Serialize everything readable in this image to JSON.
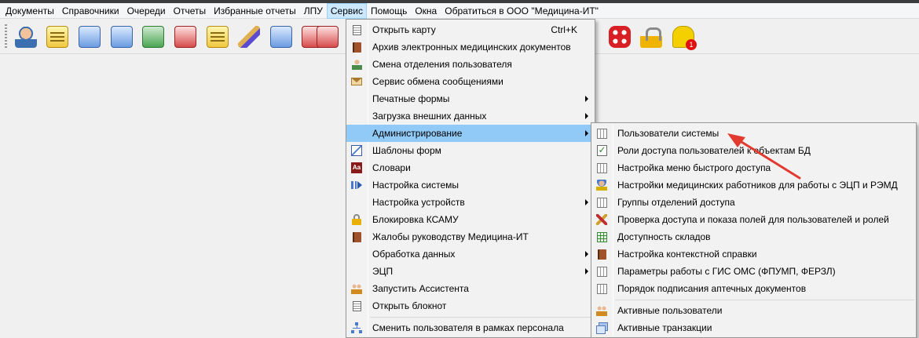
{
  "menubar": {
    "items": [
      "Документы",
      "Справочники",
      "Очереди",
      "Отчеты",
      "Избранные отчеты",
      "ЛПУ",
      "Сервис",
      "Помощь",
      "Окна",
      "Обратиться в ООО \"Медицина-ИТ\""
    ],
    "active": "Сервис"
  },
  "toolbar": {
    "icons": [
      "doctor-icon",
      "card-icon",
      "card-list-icon",
      "badge-icon",
      "card-add-icon",
      "vials-icon",
      "notepad-icon",
      "syringe-icon",
      "schedule-icon",
      "pills-icon",
      "first-aid-icon",
      "security-squares-icon",
      "lock-icon",
      "messages-icon"
    ]
  },
  "service_menu": {
    "items": [
      {
        "label": "Открыть карту",
        "shortcut": "Ctrl+K",
        "icon": "open-card-icon"
      },
      {
        "label": "Архив электронных медицинских документов",
        "icon": "archive-book-icon"
      },
      {
        "label": "Смена отделения пользователя",
        "icon": "user-icon"
      },
      {
        "label": "Сервис обмена сообщениями",
        "icon": "envelope-icon"
      },
      {
        "label": "Печатные формы",
        "submenu": true
      },
      {
        "label": "Загрузка внешних данных",
        "submenu": true
      },
      {
        "label": "Администрирование",
        "submenu": true,
        "highlighted": true
      },
      {
        "label": "Шаблоны форм",
        "icon": "form-template-icon"
      },
      {
        "label": "Словари",
        "icon": "dictionary-icon"
      },
      {
        "label": "Настройка системы",
        "icon": "system-settings-icon"
      },
      {
        "label": "Настройка устройств",
        "submenu": true
      },
      {
        "label": "Блокировка КСАМУ",
        "icon": "lock-icon"
      },
      {
        "label": "Жалобы руководству Медицина-ИТ",
        "icon": "complaint-book-icon"
      },
      {
        "label": "Обработка данных",
        "submenu": true
      },
      {
        "label": "ЭЦП",
        "submenu": true
      },
      {
        "label": "Запустить Ассистента",
        "icon": "assistant-icon"
      },
      {
        "label": "Открыть блокнот",
        "icon": "notepad-icon"
      },
      {
        "label": "Сменить пользователя в рамках персонала",
        "icon": "switch-user-icon"
      }
    ]
  },
  "admin_submenu": {
    "items": [
      {
        "label": "Пользователи системы",
        "icon": "grid-icon"
      },
      {
        "label": "Роли доступа пользователей к объектам БД",
        "icon": "certificate-icon"
      },
      {
        "label": "Настройка меню быстрого доступа",
        "icon": "grid-icon"
      },
      {
        "label": "Настройки медицинских работников для работы с ЭЦП и РЭМД",
        "icon": "medical-worker-icon"
      },
      {
        "label": "Группы отделений доступа",
        "icon": "grid-icon"
      },
      {
        "label": "Проверка доступа и показа полей для пользователей и ролей",
        "icon": "tools-icon"
      },
      {
        "label": "Доступность складов",
        "icon": "green-grid-icon"
      },
      {
        "label": "Настройка контекстной справки",
        "icon": "help-book-icon"
      },
      {
        "label": "Параметры работы с ГИС ОМС (ФПУМП, ФЕРЗЛ)",
        "icon": "grid-icon"
      },
      {
        "label": "Порядок подписания аптечных документов",
        "icon": "grid-icon"
      },
      {
        "label": "Активные пользователи",
        "icon": "users-icon"
      },
      {
        "label": "Активные транзакции",
        "icon": "transactions-icon"
      }
    ]
  },
  "colors": {
    "menubar_active": "#cce8ff",
    "menu_highlight": "#91c9f7",
    "annotation_arrow": "#e23a2e"
  }
}
